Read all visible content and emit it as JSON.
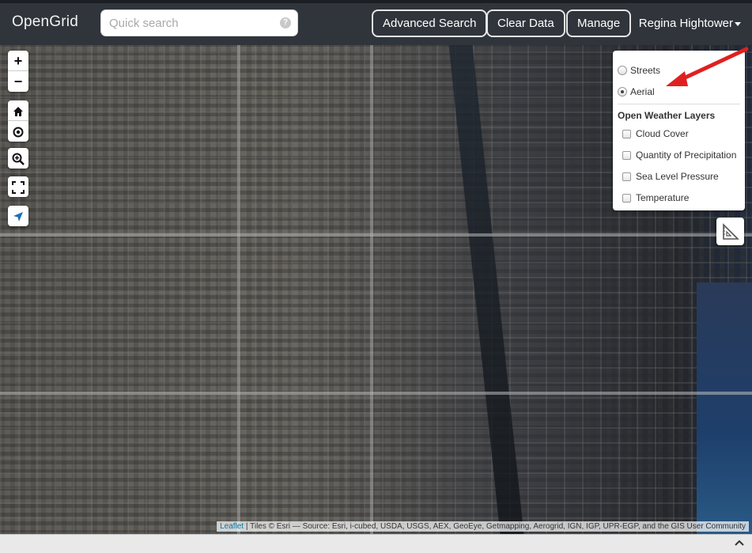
{
  "header": {
    "brand": "OpenGrid",
    "search_placeholder": "Quick search",
    "help": "?",
    "buttons": {
      "advanced_search": "Advanced Search",
      "clear_data": "Clear Data",
      "manage": "Manage"
    },
    "user_name": "Regina Hightower"
  },
  "map_controls": {
    "zoom_in": "+",
    "zoom_out": "−"
  },
  "layers": {
    "base": [
      {
        "label": "Streets",
        "selected": false
      },
      {
        "label": "Aerial",
        "selected": true
      }
    ],
    "overlay_title": "Open Weather Layers",
    "overlays": [
      {
        "label": "Cloud Cover",
        "checked": false
      },
      {
        "label": "Quantity of Precipitation",
        "checked": false
      },
      {
        "label": "Sea Level Pressure",
        "checked": false
      },
      {
        "label": "Temperature",
        "checked": false
      }
    ]
  },
  "attribution": {
    "link": "Leaflet",
    "text": " | Tiles © Esri — Source: Esri, i-cubed, USDA, USGS, AEX, GeoEye, Getmapping, Aerogrid, IGN, IGP, UPR-EGP, and the GIS User Community"
  },
  "colors": {
    "topbar": "#2f353b",
    "annotation_arrow": "#e02020",
    "attribution_link": "#0078a8"
  }
}
